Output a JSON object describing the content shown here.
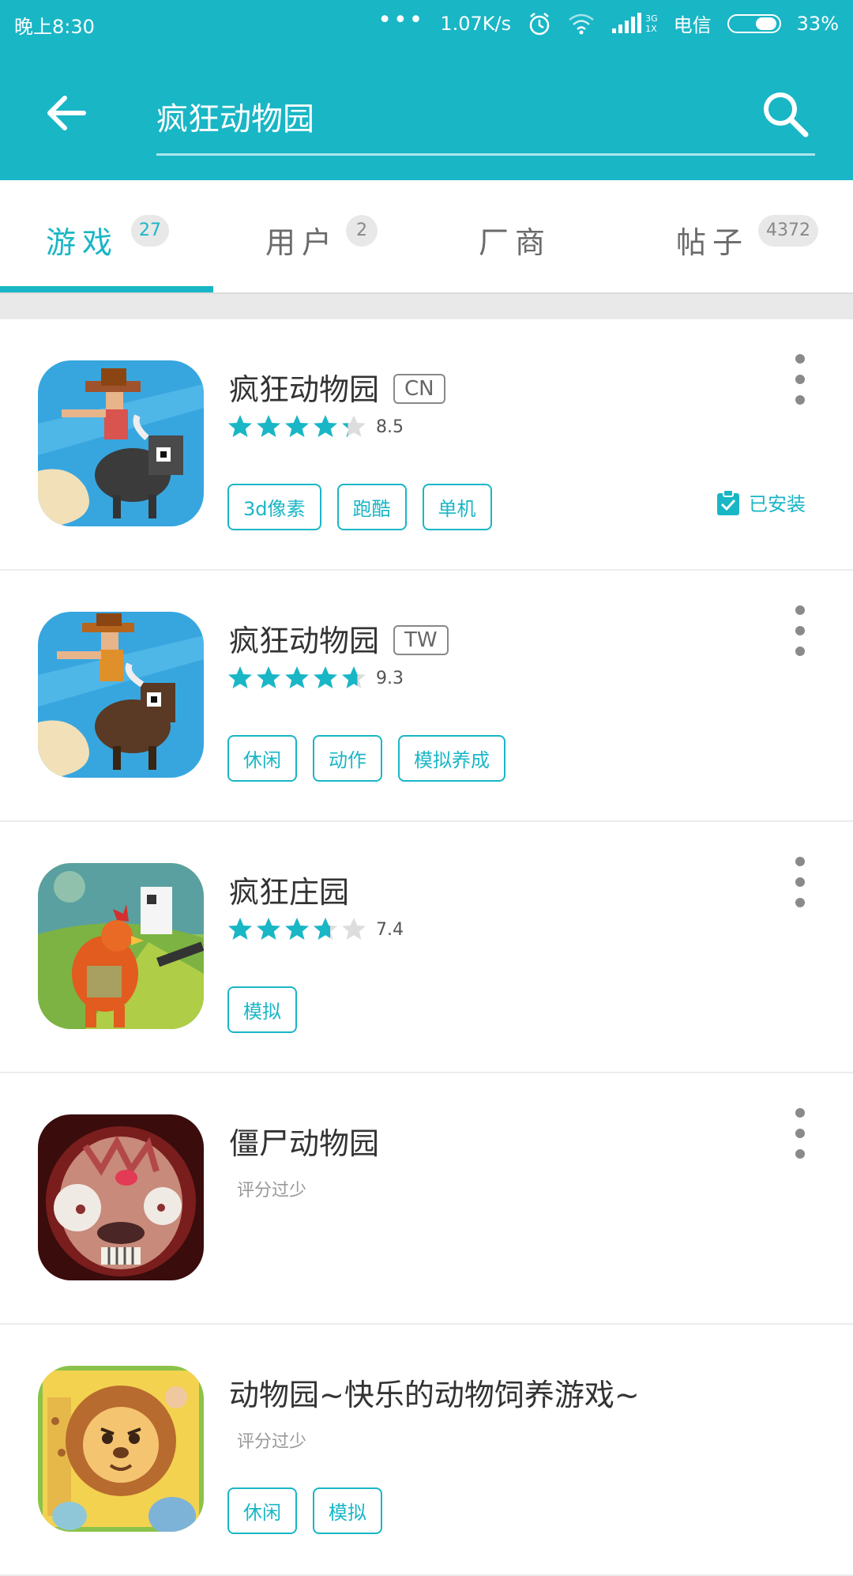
{
  "status_bar": {
    "time": "晚上8:30",
    "speed": "1.07K/s",
    "network_small_top": "3G",
    "network_small_bottom": "1X",
    "carrier": "电信",
    "battery": "33%",
    "battery_level": 0.33
  },
  "header": {
    "search_query": "疯狂动物园"
  },
  "tabs": [
    {
      "label": "游戏",
      "count": "27",
      "active": true
    },
    {
      "label": "用户",
      "count": "2",
      "active": false
    },
    {
      "label": "厂商",
      "count": "",
      "active": false
    },
    {
      "label": "帖子",
      "count": "4372",
      "active": false
    }
  ],
  "games": [
    {
      "title": "疯狂动物园",
      "badge": "CN",
      "rating": "8.5",
      "rating_value": 8.5,
      "rating_note": "",
      "tags": [
        "3d像素",
        "跑酷",
        "单机"
      ],
      "installed": "已安装"
    },
    {
      "title": "疯狂动物园",
      "badge": "TW",
      "rating": "9.3",
      "rating_value": 9.3,
      "rating_note": "",
      "tags": [
        "休闲",
        "动作",
        "模拟养成"
      ],
      "installed": ""
    },
    {
      "title": "疯狂庄园",
      "badge": "",
      "rating": "7.4",
      "rating_value": 7.4,
      "rating_note": "",
      "tags": [
        "模拟"
      ],
      "installed": ""
    },
    {
      "title": "僵尸动物园",
      "badge": "",
      "rating": "",
      "rating_value": null,
      "rating_note": "评分过少",
      "tags": [],
      "installed": ""
    },
    {
      "title": "动物园~快乐的动物饲养游戏~",
      "badge": "",
      "rating": "",
      "rating_value": null,
      "rating_note": "评分过少",
      "tags": [
        "休闲",
        "模拟"
      ],
      "installed": ""
    }
  ],
  "colors": {
    "accent": "#19b6c6",
    "star_empty": "#dddddd",
    "text_primary": "#333333",
    "text_secondary": "#999999"
  },
  "icons": {
    "back": "arrow-left-icon",
    "search": "magnifier-icon",
    "more": "vertical-dots-icon",
    "installed": "clipboard-check-icon",
    "star": "star-icon"
  }
}
